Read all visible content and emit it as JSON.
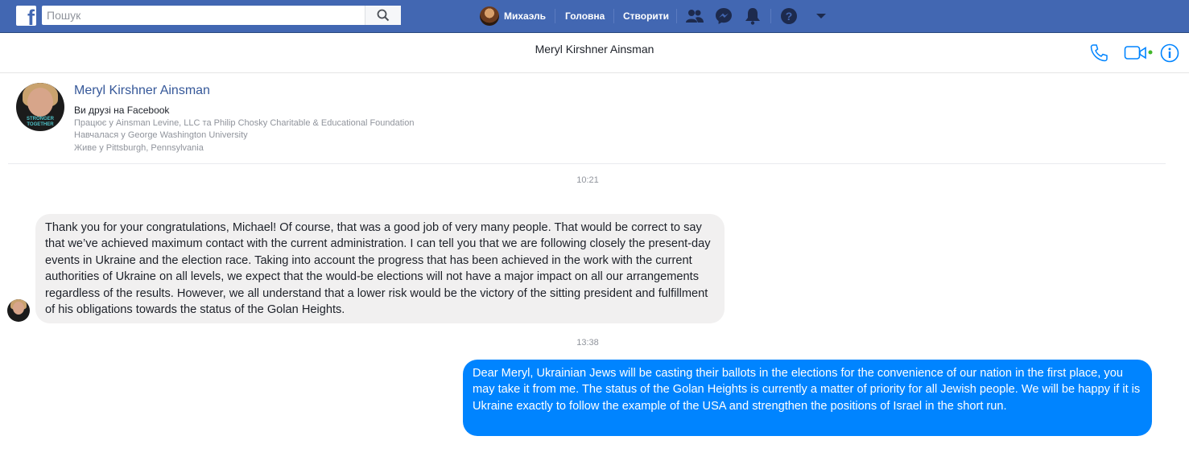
{
  "topbar": {
    "search_placeholder": "Пошук",
    "user_name": "Михаэль",
    "nav_home": "Головна",
    "nav_create": "Створити"
  },
  "chat": {
    "title": "Meryl Kirshner Ainsman"
  },
  "profile": {
    "name": "Meryl Kirshner Ainsman",
    "friends": "Ви друзі на Facebook",
    "work": "Працює у Ainsman Levine, LLC та Philip Chosky Charitable & Educational Foundation",
    "education": "Навчалася у George Washington University",
    "lives": "Живе у Pittsburgh, Pennsylvania",
    "avatar_text": "STRONGER TOGETHER"
  },
  "messages": [
    {
      "time": "10:21",
      "text": "Thank you for your congratulations, Michael! Of course, that was a good job of very many people. That would be correct to say that we’ve achieved maximum contact with the current administration. I can tell you that we are following closely the present-day events in Ukraine and the election race. Taking into account the progress that has been achieved in the work with the current authorities of Ukraine on all levels, we expect that the would-be elections will not have a major impact on all our arrangements regardless of the results. However, we all understand that a lower risk would be the victory of the sitting president and fulfillment of his obligations towards the status of the Golan Heights."
    },
    {
      "time": "13:38",
      "text": "Dear Meryl, Ukrainian Jews will be casting their ballots in the elections for the convenience of our nation in the first place, you may take it from me. The status of the Golan Heights is currently a matter of priority for all Jewish people. We will be happy if it is Ukraine exactly to follow the example of the USA and strengthen the positions of Israel in the short run."
    }
  ],
  "colors": {
    "topbar": "#4267b2",
    "outgoing_bubble": "#0084ff",
    "incoming_bubble": "#f1f0f0",
    "link": "#365899",
    "online_dot": "#42b72a"
  }
}
